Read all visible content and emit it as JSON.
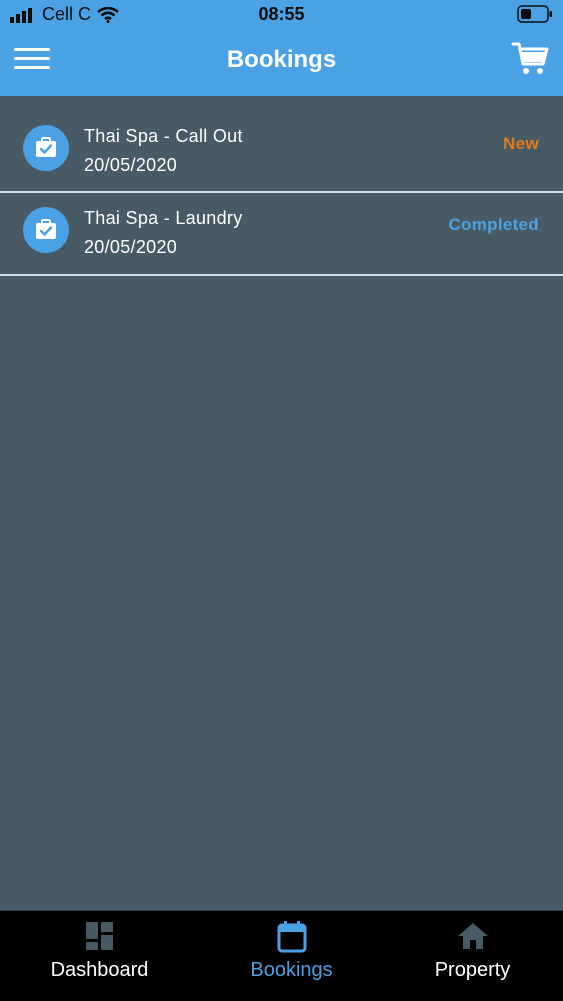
{
  "status_bar": {
    "carrier": "Cell C",
    "time": "08:55"
  },
  "header": {
    "title": "Bookings",
    "menu_icon": "hamburger-menu-icon",
    "cart_icon": "cart-icon"
  },
  "bookings": [
    {
      "title": "Thai Spa - Call Out",
      "date": "20/05/2020",
      "status": "New",
      "status_color": "#e07b1f",
      "icon": "briefcase-check-icon"
    },
    {
      "title": "Thai Spa - Laundry",
      "date": "20/05/2020",
      "status": "Completed",
      "status_color": "#4aa1e3",
      "icon": "briefcase-check-icon"
    }
  ],
  "tabs": [
    {
      "label": "Dashboard",
      "icon": "dashboard-icon",
      "active": false
    },
    {
      "label": "Bookings",
      "icon": "calendar-icon",
      "active": true
    },
    {
      "label": "Property",
      "icon": "home-icon",
      "active": false
    }
  ],
  "colors": {
    "accent": "#4aa1e3",
    "background": "#485a63",
    "tab_inactive": "#ffffff",
    "tab_active": "#4aa1e3",
    "icon_inactive": "#485a63"
  }
}
